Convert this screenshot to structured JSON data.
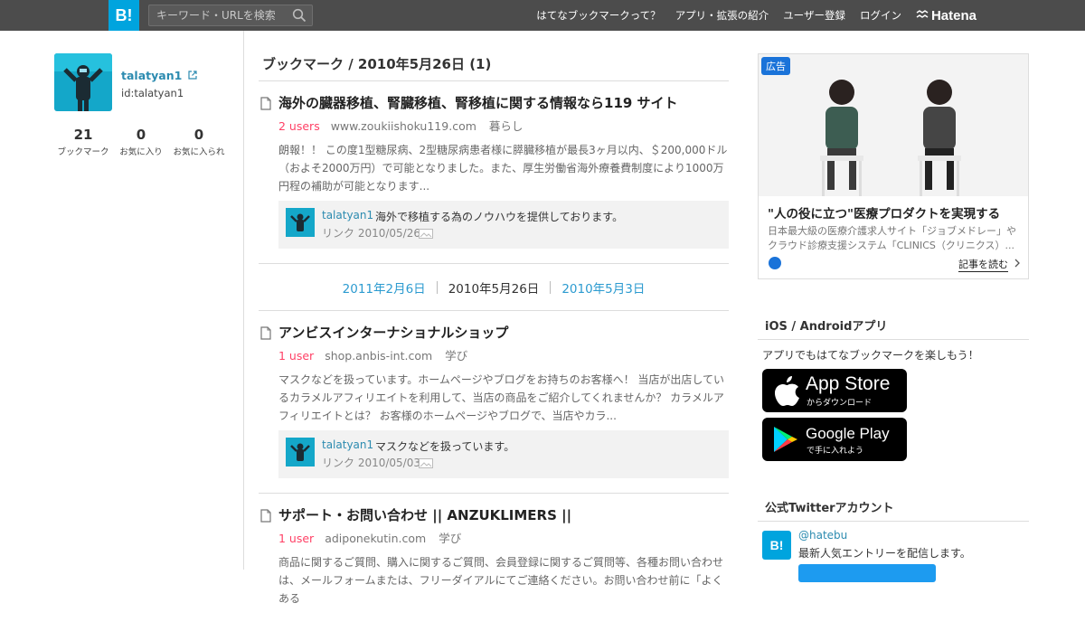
{
  "header": {
    "logo": "B!",
    "search_placeholder": "キーワード・URLを検索",
    "nav": [
      "はてなブックマークって？",
      "アプリ・拡張の紹介",
      "ユーザー登録",
      "ログイン"
    ],
    "hatena": "Hatena"
  },
  "profile": {
    "name": "talatyan1",
    "id": "id:talatyan1",
    "stats": [
      {
        "value": "21",
        "label": "ブックマーク"
      },
      {
        "value": "0",
        "label": "お気に入り"
      },
      {
        "value": "0",
        "label": "お気に入られ"
      }
    ]
  },
  "main": {
    "page_title": "ブックマーク / 2010年5月26日 (1)",
    "entries": [
      {
        "title": "海外の臓器移植、腎臓移植、腎移植に関する情報なら119 サイト",
        "users": "2 users",
        "domain": "www.zoukiishoku119.com",
        "category": "暮らし",
        "desc": "朗報！！ この度1型糖尿病、2型糖尿病患者様に膵臓移植が最長3ヶ月以内、＄200,000ドル（およそ2000万円）で可能となりました。また、厚生労働省海外療養費制度により1000万円程の補助が可能となります...",
        "comment_user": "talatyan1",
        "comment": "海外で移植する為のノウハウを提供しております。",
        "comment_date": "リンク 2010/05/26"
      },
      {
        "title": "アンビスインターナショナルショップ",
        "users": "1 user",
        "domain": "shop.anbis-int.com",
        "category": "学び",
        "desc": "マスクなどを扱っています。ホームページやブログをお持ちのお客様へ！ 当店が出店しているカラメルアフィリエイトを利用して、当店の商品をご紹介してくれませんか？ カラメルアフィリエイトとは？ お客様のホームページやブログで、当店やカラ...",
        "comment_user": "talatyan1",
        "comment": "マスクなどを扱っています。",
        "comment_date": "リンク 2010/05/03"
      },
      {
        "title": "サポート・お問い合わせ || ANZUKLIMERS ||",
        "users": "1 user",
        "domain": "adiponekutin.com",
        "category": "学び",
        "desc": "商品に関するご質問、購入に関するご質問、会員登録に関するご質問等、各種お問い合わせは、メールフォームまたは、フリーダイアルにてご連絡ください。お問い合わせ前に「よくある"
      }
    ],
    "pager": {
      "prev": "2011年2月6日",
      "current": "2010年5月26日",
      "next": "2010年5月3日"
    }
  },
  "sidebar": {
    "ad": {
      "badge": "広告",
      "headline": "\"人の役に立つ\"医療プロダクトを実現する",
      "sub": "日本最大級の医療介護求人サイト「ジョブメドレー」やクラウド診療支援システム「CLINICS（クリニクス）...",
      "more": "記事を読む"
    },
    "apps": {
      "title": "iOS / Androidアプリ",
      "text": "アプリでもはてなブックマークを楽しもう！",
      "appstore_big": "App Store",
      "appstore_small": "からダウンロード",
      "gplay_big": "Google Play",
      "gplay_small": "で手に入れよう"
    },
    "twitter": {
      "title": "公式Twitterアカウント",
      "logo": "B!",
      "handle": "@hatebu",
      "desc": "最新人気エントリーを配信します。"
    }
  }
}
